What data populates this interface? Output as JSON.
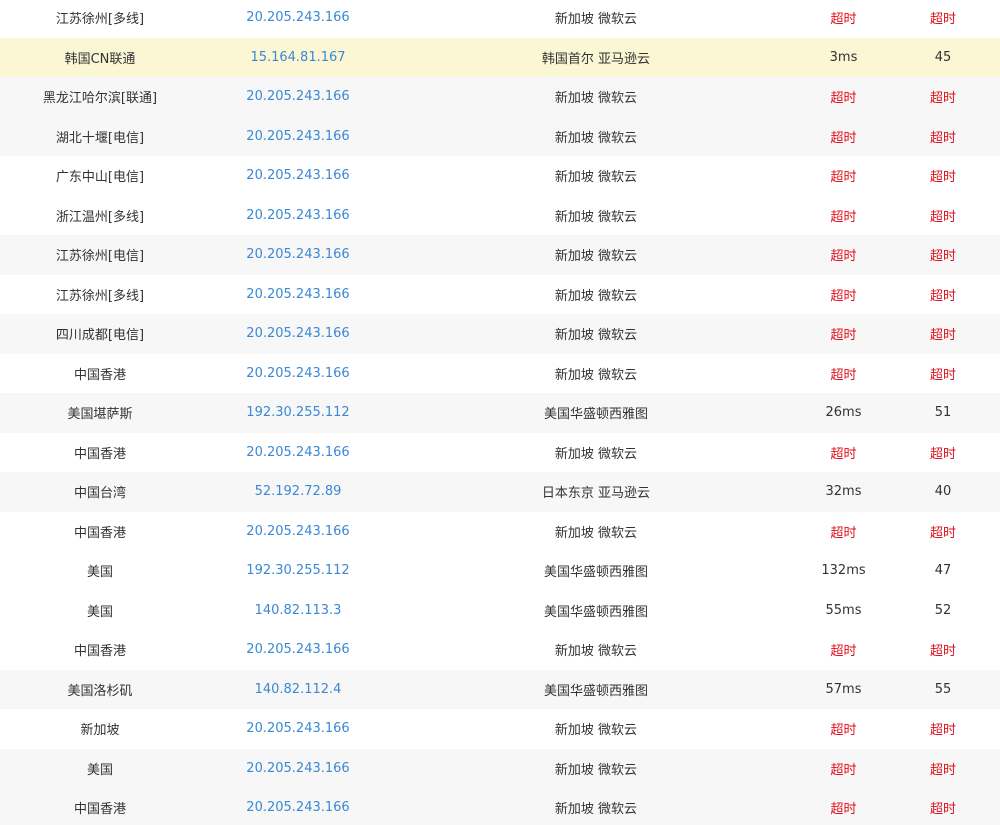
{
  "colors": {
    "link": "#3a88d6",
    "timeout": "#e0101a",
    "row_alt": "#f7f7f7",
    "row_highlight": "#fbf7d4"
  },
  "rows": [
    {
      "location": "江苏徐州[多线]",
      "ip": "20.205.243.166",
      "dest": "新加坡 微软云",
      "time": "超时",
      "ttl": "超时",
      "timeout": true,
      "style": "plain"
    },
    {
      "location": "韩国CN联通",
      "ip": "15.164.81.167",
      "dest": "韩国首尔 亚马逊云",
      "time": "3ms",
      "ttl": "45",
      "timeout": false,
      "style": "hl"
    },
    {
      "location": "黑龙江哈尔滨[联通]",
      "ip": "20.205.243.166",
      "dest": "新加坡 微软云",
      "time": "超时",
      "ttl": "超时",
      "timeout": true,
      "style": "alt"
    },
    {
      "location": "湖北十堰[电信]",
      "ip": "20.205.243.166",
      "dest": "新加坡 微软云",
      "time": "超时",
      "ttl": "超时",
      "timeout": true,
      "style": "alt"
    },
    {
      "location": "广东中山[电信]",
      "ip": "20.205.243.166",
      "dest": "新加坡 微软云",
      "time": "超时",
      "ttl": "超时",
      "timeout": true,
      "style": "plain"
    },
    {
      "location": "浙江温州[多线]",
      "ip": "20.205.243.166",
      "dest": "新加坡 微软云",
      "time": "超时",
      "ttl": "超时",
      "timeout": true,
      "style": "plain"
    },
    {
      "location": "江苏徐州[电信]",
      "ip": "20.205.243.166",
      "dest": "新加坡 微软云",
      "time": "超时",
      "ttl": "超时",
      "timeout": true,
      "style": "alt"
    },
    {
      "location": "江苏徐州[多线]",
      "ip": "20.205.243.166",
      "dest": "新加坡 微软云",
      "time": "超时",
      "ttl": "超时",
      "timeout": true,
      "style": "plain"
    },
    {
      "location": "四川成都[电信]",
      "ip": "20.205.243.166",
      "dest": "新加坡 微软云",
      "time": "超时",
      "ttl": "超时",
      "timeout": true,
      "style": "alt"
    },
    {
      "location": "中国香港",
      "ip": "20.205.243.166",
      "dest": "新加坡 微软云",
      "time": "超时",
      "ttl": "超时",
      "timeout": true,
      "style": "plain"
    },
    {
      "location": "美国堪萨斯",
      "ip": "192.30.255.112",
      "dest": "美国华盛顿西雅图",
      "time": "26ms",
      "ttl": "51",
      "timeout": false,
      "style": "alt"
    },
    {
      "location": "中国香港",
      "ip": "20.205.243.166",
      "dest": "新加坡 微软云",
      "time": "超时",
      "ttl": "超时",
      "timeout": true,
      "style": "plain"
    },
    {
      "location": "中国台湾",
      "ip": "52.192.72.89",
      "dest": "日本东京 亚马逊云",
      "time": "32ms",
      "ttl": "40",
      "timeout": false,
      "style": "alt"
    },
    {
      "location": "中国香港",
      "ip": "20.205.243.166",
      "dest": "新加坡 微软云",
      "time": "超时",
      "ttl": "超时",
      "timeout": true,
      "style": "plain"
    },
    {
      "location": "美国",
      "ip": "192.30.255.112",
      "dest": "美国华盛顿西雅图",
      "time": "132ms",
      "ttl": "47",
      "timeout": false,
      "style": "plain"
    },
    {
      "location": "美国",
      "ip": "140.82.113.3",
      "dest": "美国华盛顿西雅图",
      "time": "55ms",
      "ttl": "52",
      "timeout": false,
      "style": "plain"
    },
    {
      "location": "中国香港",
      "ip": "20.205.243.166",
      "dest": "新加坡 微软云",
      "time": "超时",
      "ttl": "超时",
      "timeout": true,
      "style": "plain"
    },
    {
      "location": "美国洛杉矶",
      "ip": "140.82.112.4",
      "dest": "美国华盛顿西雅图",
      "time": "57ms",
      "ttl": "55",
      "timeout": false,
      "style": "alt"
    },
    {
      "location": "新加坡",
      "ip": "20.205.243.166",
      "dest": "新加坡 微软云",
      "time": "超时",
      "ttl": "超时",
      "timeout": true,
      "style": "plain"
    },
    {
      "location": "美国",
      "ip": "20.205.243.166",
      "dest": "新加坡 微软云",
      "time": "超时",
      "ttl": "超时",
      "timeout": true,
      "style": "alt"
    },
    {
      "location": "中国香港",
      "ip": "20.205.243.166",
      "dest": "新加坡 微软云",
      "time": "超时",
      "ttl": "超时",
      "timeout": true,
      "style": "alt"
    }
  ]
}
